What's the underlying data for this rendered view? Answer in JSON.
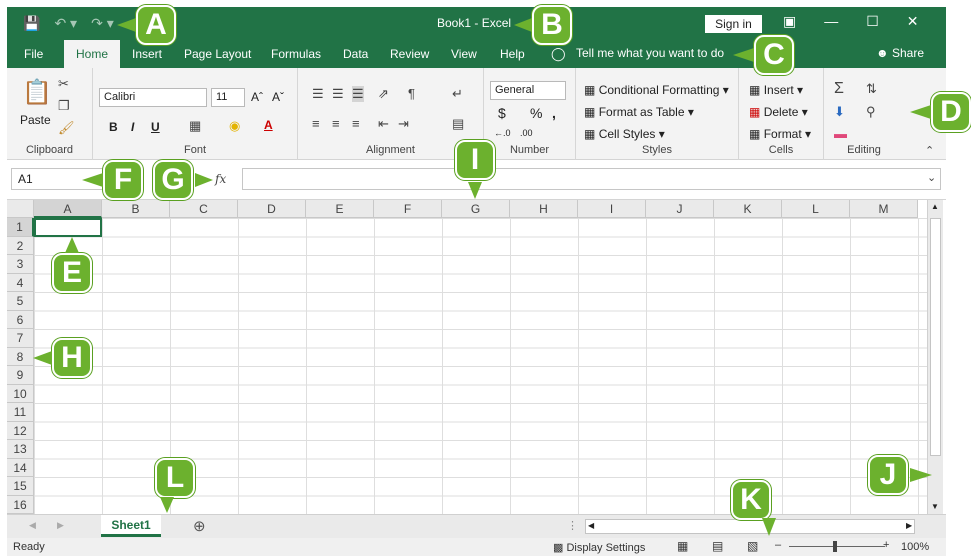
{
  "title_bar": {
    "title": "Book1  -  Excel",
    "sign_in": "Sign in"
  },
  "tabs": [
    "File",
    "Home",
    "Insert",
    "Page Layout",
    "Formulas",
    "Data",
    "Review",
    "View",
    "Help"
  ],
  "tell_me": "Tell me what you want to do",
  "share": "Share",
  "ribbon": {
    "clipboard": {
      "paste": "Paste",
      "label": "Clipboard"
    },
    "font": {
      "name": "Calibri",
      "size": "11",
      "label": "Font",
      "bold": "B",
      "italic": "I",
      "underline": "U",
      "grow": "Aˆ",
      "shrink": "Aˇ",
      "color": "A"
    },
    "alignment": {
      "label": "Alignment"
    },
    "number": {
      "format": "General",
      "label": "Number",
      "currency": "$",
      "percent": "%",
      "comma": ",",
      "inc": "←.0",
      "dec": ".00"
    },
    "styles": {
      "conditional": "Conditional Formatting",
      "table": "Format as Table",
      "cell": "Cell Styles",
      "label": "Styles"
    },
    "cells": {
      "insert": "Insert",
      "delete": "Delete",
      "format": "Format",
      "label": "Cells"
    },
    "editing": {
      "label": "Editing"
    }
  },
  "formula_bar": {
    "name_box": "A1",
    "fx": "fx"
  },
  "columns": [
    "A",
    "B",
    "C",
    "D",
    "E",
    "F",
    "G",
    "H",
    "I",
    "J",
    "K",
    "L",
    "M"
  ],
  "rows": [
    "1",
    "2",
    "3",
    "4",
    "5",
    "6",
    "7",
    "8",
    "9",
    "10",
    "11",
    "12",
    "13",
    "14",
    "15",
    "16"
  ],
  "sheet_tab": "Sheet1",
  "status": {
    "ready": "Ready",
    "display_settings": "Display Settings",
    "zoom": "100%"
  },
  "callouts": [
    "A",
    "B",
    "C",
    "D",
    "E",
    "F",
    "G",
    "H",
    "I",
    "J",
    "K",
    "L"
  ],
  "colors": {
    "excel_green": "#217346",
    "callout_green": "#6cb12e"
  }
}
